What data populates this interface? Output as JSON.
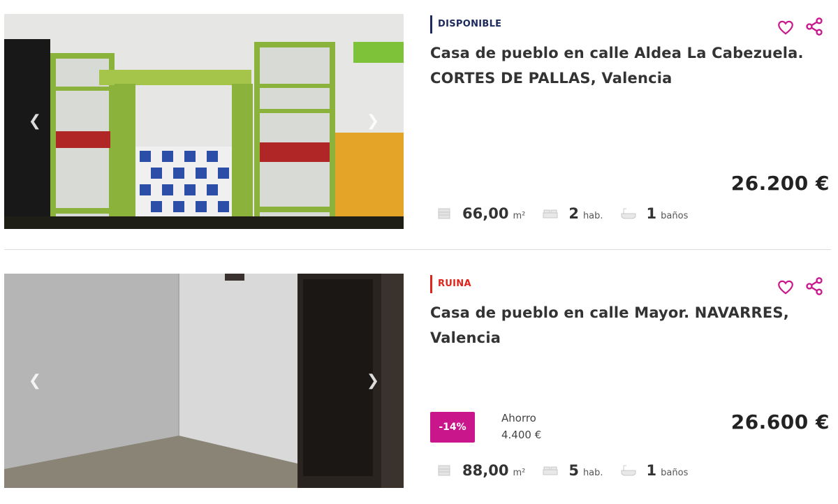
{
  "listings": [
    {
      "status": "DISPONIBLE",
      "title": "Casa de pueblo en calle Aldea La Cabezuela. CORTES DE PALLAS, Valencia",
      "price": "26.200 €",
      "area_value": "66,00",
      "area_unit": "m²",
      "rooms_value": "2",
      "rooms_unit": "hab.",
      "baths_value": "1",
      "baths_unit": "baños"
    },
    {
      "status": "RUINA",
      "title": "Casa de pueblo en calle Mayor. NAVARRES, Valencia",
      "price": "26.600 €",
      "discount": "-14%",
      "saving_label": "Ahorro",
      "saving_value": "4.400 €",
      "area_value": "88,00",
      "area_unit": "m²",
      "rooms_value": "5",
      "rooms_unit": "hab.",
      "baths_value": "1",
      "baths_unit": "baños"
    }
  ],
  "icons": {
    "prev": "chevron-left-icon",
    "next": "chevron-right-icon",
    "favorite": "heart-icon",
    "share": "share-icon",
    "area": "area-icon",
    "rooms": "bed-icon",
    "baths": "bath-icon"
  },
  "colors": {
    "accent": "#c9168b",
    "available": "#1c2a5e",
    "ruin": "#e2231a"
  }
}
